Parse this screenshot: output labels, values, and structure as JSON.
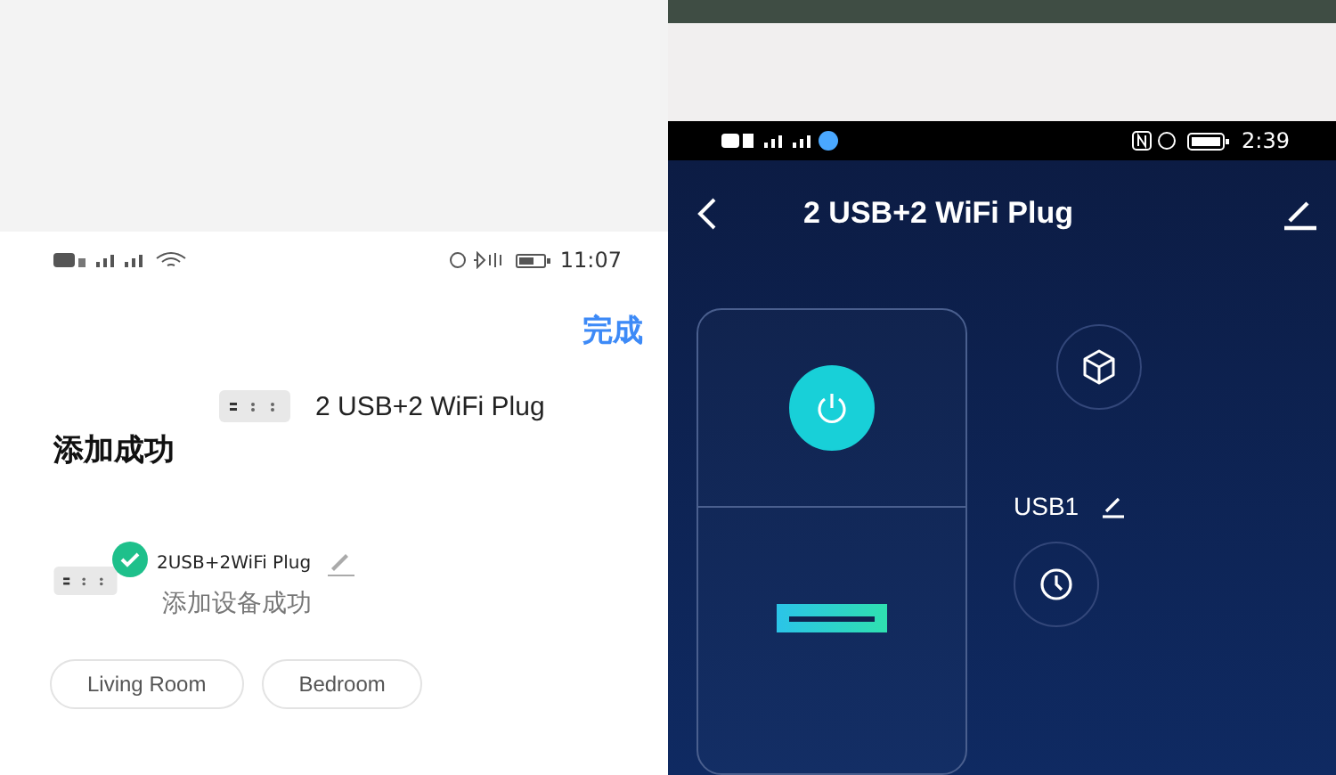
{
  "left_screen": {
    "status_bar": {
      "time": "11:07"
    },
    "done_button": "完成",
    "device_name": "2 USB+2 WiFi Plug",
    "title": "添加成功",
    "device_card": {
      "name": "2USB+2WiFi Plug",
      "status": "添加设备成功",
      "added": true
    },
    "rooms": [
      {
        "label": "Living Room",
        "selected": false
      },
      {
        "label": "Bedroom",
        "selected": false
      }
    ]
  },
  "right_screen": {
    "status_bar": {
      "time": "2:39"
    },
    "title": "2 USB+2 WiFi Plug",
    "power": {
      "on": true
    },
    "usb_label": "USB1"
  }
}
